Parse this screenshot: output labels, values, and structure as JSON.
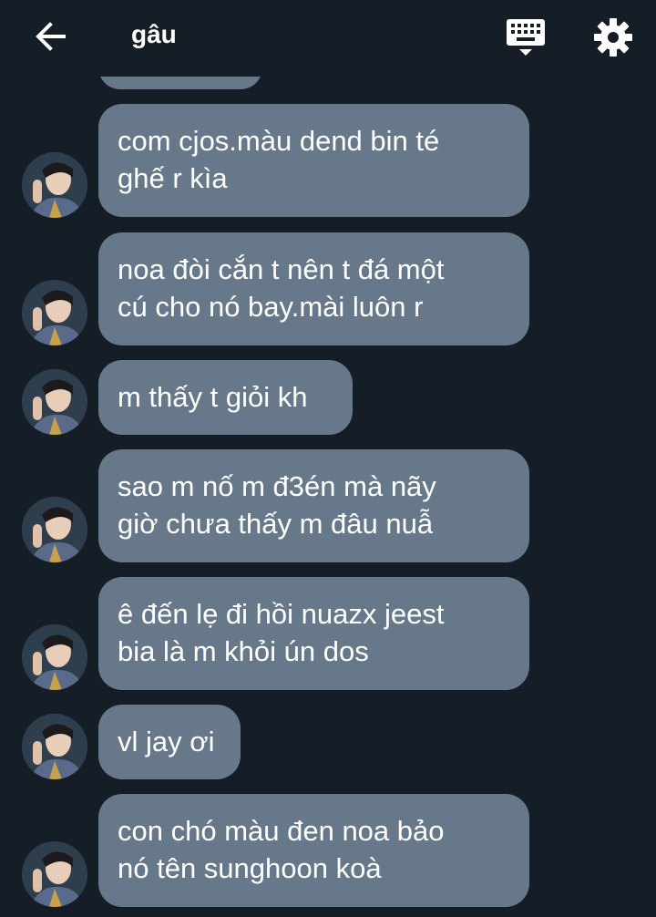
{
  "header": {
    "title": "gâu",
    "back_icon": "arrow-left-icon",
    "keyboard_icon": "keyboard-icon",
    "settings_icon": "gear-icon"
  },
  "colors": {
    "background": "#151d27",
    "bubble": "#667889",
    "text": "#ffffff"
  },
  "messages": [
    {
      "text": "com cjos.màu dend bin té\nghế r kìa"
    },
    {
      "text": "noa đòi cắn t nên t đá một\ncú cho nó bay.mài luôn r"
    },
    {
      "text": "m thấy t giỏi kh"
    },
    {
      "text": "sao m nố m đ3én mà nãy\ngiờ chưa thấy m đâu nuẫ"
    },
    {
      "text": "ê đến lẹ đi hồi nuazx jeest\nbia là m khỏi ún dos"
    },
    {
      "text": "vl jay ơi"
    },
    {
      "text": "con chó màu đen noa bảo\nnó tên sunghoon koà"
    }
  ]
}
